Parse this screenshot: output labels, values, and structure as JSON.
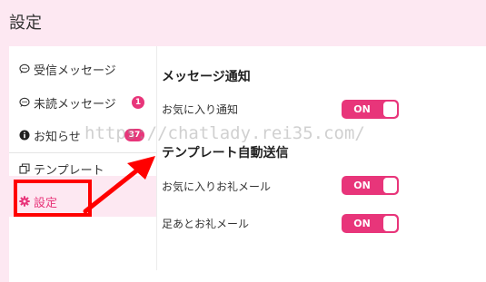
{
  "page": {
    "title": "設定"
  },
  "sidebar": {
    "items": [
      {
        "label": "受信メッセージ",
        "icon": "chat-bubble-icon"
      },
      {
        "label": "未読メッセージ",
        "icon": "chat-bubble-icon",
        "badge": "1"
      },
      {
        "label": "お知らせ",
        "icon": "info-icon",
        "badge": "37"
      },
      {
        "label": "テンプレート",
        "icon": "copy-icon"
      },
      {
        "label": "設定",
        "icon": "gear-icon",
        "active": true
      }
    ]
  },
  "main": {
    "sections": [
      {
        "title": "メッセージ通知",
        "rows": [
          {
            "label": "お気に入り通知",
            "toggle": "ON"
          }
        ]
      },
      {
        "title": "テンプレート自動送信",
        "rows": [
          {
            "label": "お気に入りお礼メール",
            "toggle": "ON"
          },
          {
            "label": "足あとお礼メール",
            "toggle": "ON"
          }
        ]
      }
    ]
  },
  "watermark": "https://chatlady.rei35.com/",
  "colors": {
    "accent": "#e8357a",
    "annotation": "#ff0000",
    "background": "#fde8f2"
  }
}
